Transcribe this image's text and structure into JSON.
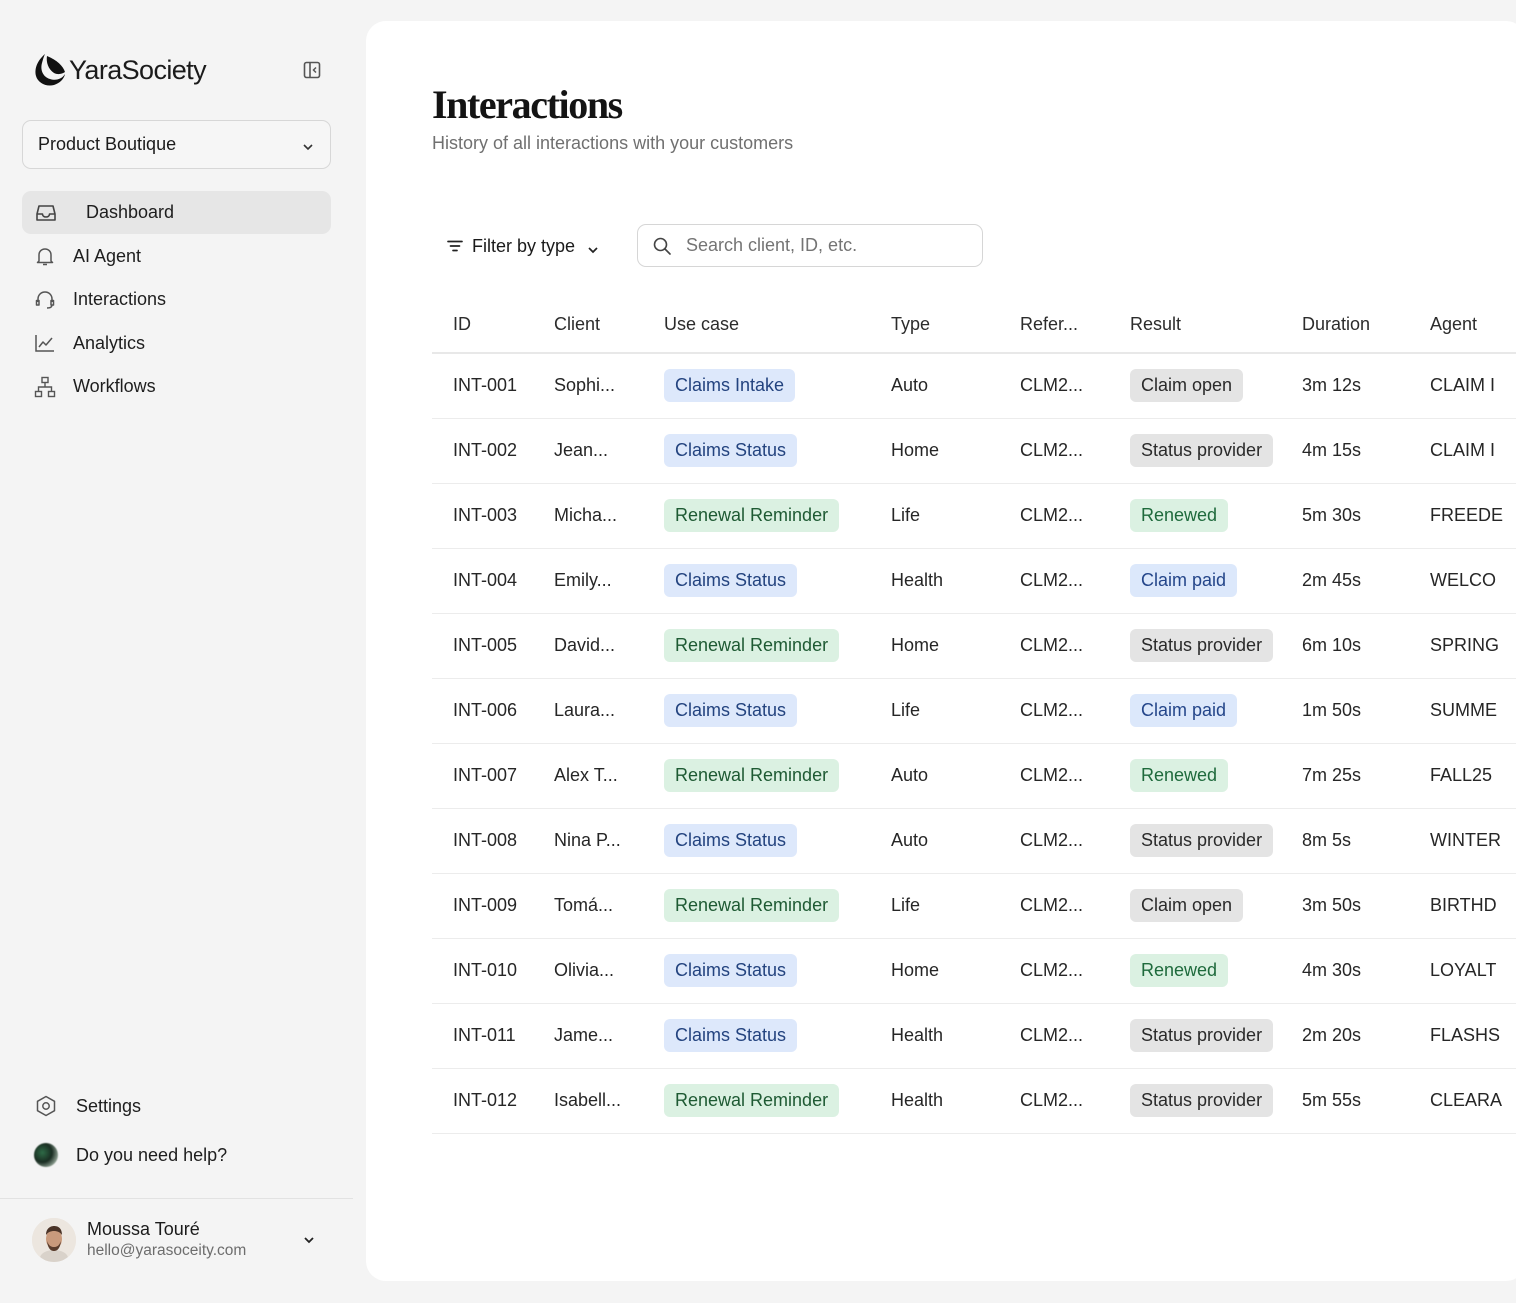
{
  "brand": {
    "name": "YaraSociety"
  },
  "workspace": {
    "selected": "Product Boutique"
  },
  "nav": [
    {
      "label": "Dashboard",
      "icon": "inbox-icon",
      "active": true
    },
    {
      "label": "AI Agent",
      "icon": "bell-icon",
      "active": false
    },
    {
      "label": "Interactions",
      "icon": "headset-icon",
      "active": false
    },
    {
      "label": "Analytics",
      "icon": "chart-line-icon",
      "active": false
    },
    {
      "label": "Workflows",
      "icon": "workflow-icon",
      "active": false
    }
  ],
  "bottom": {
    "settings_label": "Settings",
    "help_label": "Do you need help?"
  },
  "user": {
    "name": "Moussa Touré",
    "email": "hello@yarasoceity.com"
  },
  "page": {
    "title": "Interactions",
    "subtitle": "History of all interactions with your customers"
  },
  "toolbar": {
    "filter_label": "Filter by type",
    "search_placeholder": "Search client, ID, etc."
  },
  "table": {
    "columns": [
      "ID",
      "Client",
      "Use case",
      "Type",
      "Refer...",
      "Result",
      "Duration",
      "Agent"
    ],
    "rows": [
      {
        "id": "INT-001",
        "client": "Sophi...",
        "use_case": "Claims Intake",
        "use_tone": "blue",
        "type": "Auto",
        "ref": "CLM2...",
        "result": "Claim open",
        "result_tone": "gray",
        "duration": "3m 12s",
        "agent": "CLAIM I"
      },
      {
        "id": "INT-002",
        "client": "Jean...",
        "use_case": "Claims Status",
        "use_tone": "blue",
        "type": "Home",
        "ref": "CLM2...",
        "result": "Status provider",
        "result_tone": "gray",
        "duration": "4m 15s",
        "agent": "CLAIM I"
      },
      {
        "id": "INT-003",
        "client": "Micha...",
        "use_case": "Renewal Reminder",
        "use_tone": "green",
        "type": "Life",
        "ref": "CLM2...",
        "result": "Renewed",
        "result_tone": "teal",
        "duration": "5m 30s",
        "agent": "FREEDE"
      },
      {
        "id": "INT-004",
        "client": "Emily...",
        "use_case": "Claims Status",
        "use_tone": "blue",
        "type": "Health",
        "ref": "CLM2...",
        "result": "Claim paid",
        "result_tone": "lblue",
        "duration": "2m 45s",
        "agent": "WELCO"
      },
      {
        "id": "INT-005",
        "client": "David...",
        "use_case": "Renewal Reminder",
        "use_tone": "green",
        "type": "Home",
        "ref": "CLM2...",
        "result": "Status provider",
        "result_tone": "gray",
        "duration": "6m 10s",
        "agent": "SPRING"
      },
      {
        "id": "INT-006",
        "client": "Laura...",
        "use_case": "Claims Status",
        "use_tone": "blue",
        "type": "Life",
        "ref": "CLM2...",
        "result": "Claim paid",
        "result_tone": "lblue",
        "duration": "1m 50s",
        "agent": "SUMME"
      },
      {
        "id": "INT-007",
        "client": "Alex T...",
        "use_case": "Renewal Reminder",
        "use_tone": "green",
        "type": "Auto",
        "ref": "CLM2...",
        "result": "Renewed",
        "result_tone": "teal",
        "duration": "7m 25s",
        "agent": "FALL25"
      },
      {
        "id": "INT-008",
        "client": "Nina P...",
        "use_case": "Claims Status",
        "use_tone": "blue",
        "type": "Auto",
        "ref": "CLM2...",
        "result": "Status provider",
        "result_tone": "gray",
        "duration": "8m 5s",
        "agent": "WINTER"
      },
      {
        "id": "INT-009",
        "client": "Tomá...",
        "use_case": "Renewal Reminder",
        "use_tone": "green",
        "type": "Life",
        "ref": "CLM2...",
        "result": "Claim open",
        "result_tone": "gray",
        "duration": "3m 50s",
        "agent": "BIRTHD"
      },
      {
        "id": "INT-010",
        "client": "Olivia...",
        "use_case": "Claims Status",
        "use_tone": "blue",
        "type": "Home",
        "ref": "CLM2...",
        "result": "Renewed",
        "result_tone": "teal",
        "duration": "4m 30s",
        "agent": "LOYALT"
      },
      {
        "id": "INT-011",
        "client": "Jame...",
        "use_case": "Claims Status",
        "use_tone": "blue",
        "type": "Health",
        "ref": "CLM2...",
        "result": "Status provider",
        "result_tone": "gray",
        "duration": "2m 20s",
        "agent": "FLASHS"
      },
      {
        "id": "INT-012",
        "client": "Isabell...",
        "use_case": "Renewal Reminder",
        "use_tone": "green",
        "type": "Health",
        "ref": "CLM2...",
        "result": "Status provider",
        "result_tone": "gray",
        "duration": "5m 55s",
        "agent": "CLEARA"
      }
    ]
  },
  "colors": {
    "page_bg": "#f4f4f4",
    "panel_bg": "#ffffff",
    "active_nav_bg": "#e6e6e6",
    "pill_blue_bg": "#dde8fb",
    "pill_green_bg": "#dbf1e2",
    "pill_gray_bg": "#e4e4e4"
  }
}
